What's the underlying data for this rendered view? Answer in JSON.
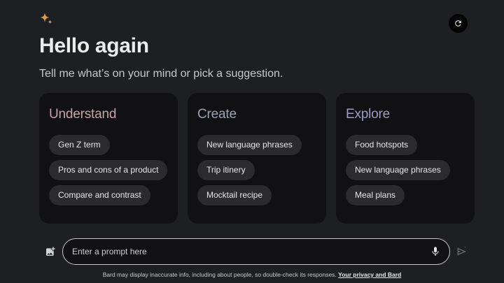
{
  "header": {
    "logo_icon": "sparkle-icon",
    "refresh_icon": "refresh-icon"
  },
  "hero": {
    "greeting": "Hello again",
    "subtitle": "Tell me what’s on your mind or pick a suggestion."
  },
  "cards": [
    {
      "title": "Understand",
      "title_color": "#c7a3a8",
      "chips": [
        "Gen Z term",
        "Pros and cons of a product",
        "Compare and contrast"
      ]
    },
    {
      "title": "Create",
      "title_color": "#9aa3b3",
      "chips": [
        "New language phrases",
        "Trip itinery",
        "Mocktail recipe"
      ]
    },
    {
      "title": "Explore",
      "title_color": "#9d9bc4",
      "chips": [
        "Food hotspots",
        "New language phrases",
        "Meal plans"
      ]
    }
  ],
  "prompt": {
    "placeholder": "Enter a prompt here",
    "image_icon": "add-image-icon",
    "mic_icon": "microphone-icon",
    "send_icon": "send-icon"
  },
  "footer": {
    "disclaimer": "Bard may display inaccurate info, including about people, so double-check its responses.",
    "link": "Your privacy and Bard"
  },
  "colors": {
    "background": "#1e1f22",
    "card": "#111113",
    "chip": "#2b2b2e",
    "sparkle": "#d89a4e"
  }
}
